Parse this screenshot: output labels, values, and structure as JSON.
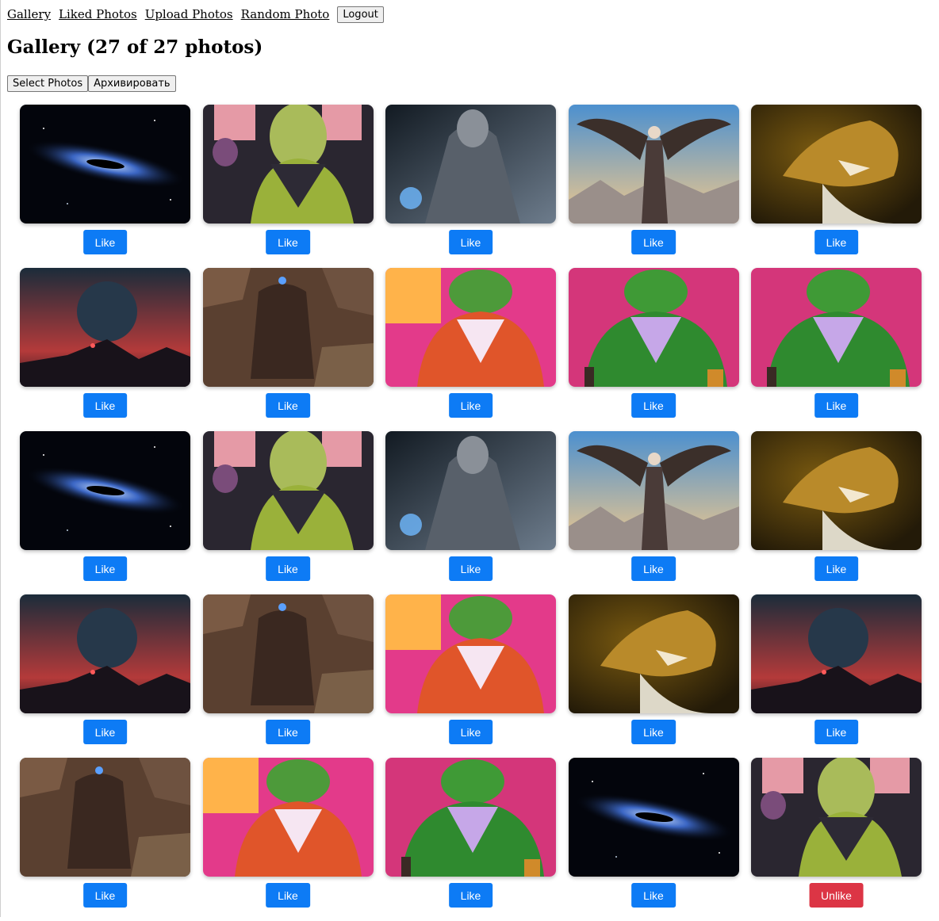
{
  "nav": {
    "links": [
      "Gallery",
      "Liked Photos",
      "Upload Photos",
      "Random Photo"
    ],
    "logout_label": "Logout"
  },
  "page_title": "Gallery (27 of 27 photos)",
  "actions": {
    "select_label": "Select Photos",
    "archive_label": "Архивировать"
  },
  "colors": {
    "like": "#0d7bf5",
    "unlike": "#dc3545"
  },
  "photos": [
    {
      "image": "galaxy-black-hole",
      "button": "Like"
    },
    {
      "image": "frog-muscle-dark",
      "button": "Like"
    },
    {
      "image": "armored-warrior",
      "button": "Like"
    },
    {
      "image": "winged-angel",
      "button": "Like"
    },
    {
      "image": "golden-dragon",
      "button": "Like"
    },
    {
      "image": "red-planet-landscape",
      "button": "Like"
    },
    {
      "image": "armored-dwarf-rocks",
      "button": "Like"
    },
    {
      "image": "frog-muscle-neon",
      "button": "Like"
    },
    {
      "image": "frog-muscle-pink",
      "button": "Like"
    },
    {
      "image": "frog-muscle-pink",
      "button": "Like"
    },
    {
      "image": "galaxy-black-hole",
      "button": "Like"
    },
    {
      "image": "frog-muscle-dark",
      "button": "Like"
    },
    {
      "image": "armored-warrior",
      "button": "Like"
    },
    {
      "image": "winged-angel",
      "button": "Like"
    },
    {
      "image": "golden-dragon",
      "button": "Like"
    },
    {
      "image": "red-planet-landscape",
      "button": "Like"
    },
    {
      "image": "armored-dwarf-rocks",
      "button": "Like"
    },
    {
      "image": "frog-muscle-neon",
      "button": "Like"
    },
    {
      "image": "golden-dragon",
      "button": "Like"
    },
    {
      "image": "red-planet-landscape",
      "button": "Like"
    },
    {
      "image": "armored-dwarf-rocks",
      "button": "Like"
    },
    {
      "image": "frog-muscle-neon",
      "button": "Like"
    },
    {
      "image": "frog-muscle-pink",
      "button": "Like"
    },
    {
      "image": "galaxy-black-hole",
      "button": "Like"
    },
    {
      "image": "frog-muscle-dark",
      "button": "Unlike"
    }
  ]
}
